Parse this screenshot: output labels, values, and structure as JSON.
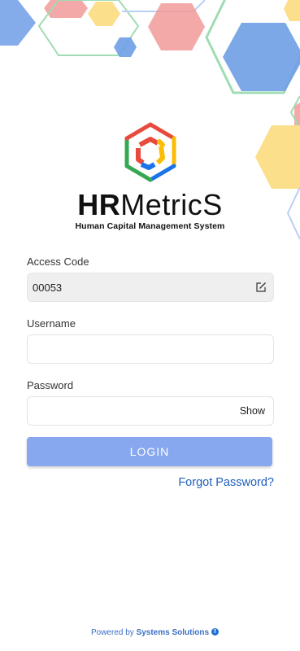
{
  "brand": {
    "name_bold": "HR",
    "name_rest": "MetricS",
    "tagline": "Human Capital Management System"
  },
  "form": {
    "access_code": {
      "label": "Access Code",
      "value": "00053"
    },
    "username": {
      "label": "Username",
      "value": ""
    },
    "password": {
      "label": "Password",
      "value": "",
      "toggle_label": "Show"
    },
    "login_label": "LOGIN",
    "forgot_label": "Forgot Password?"
  },
  "footer": {
    "powered_prefix": "Powered by",
    "company": "Systems Solutions",
    "info_glyph": "!"
  },
  "colors": {
    "accent": "#87a8ee",
    "link": "#1f5fbf",
    "hex_blue": "#6e9ee6",
    "hex_red": "#f19a98",
    "hex_yellow": "#fcdf8a",
    "hex_green": "#9fdcb3"
  },
  "icons": {
    "edit": "edit-icon",
    "info": "info-icon",
    "logo": "hrmetrics-logo-icon"
  }
}
